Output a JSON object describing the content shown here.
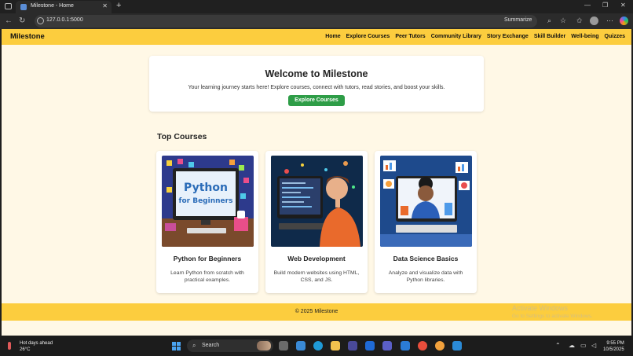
{
  "browser": {
    "tab_title": "Milestone - Home",
    "url": "127.0.0.1:5000",
    "summarize_label": "Summarize"
  },
  "site": {
    "brand": "Milestone",
    "nav": [
      "Home",
      "Explore Courses",
      "Peer Tutors",
      "Community Library",
      "Story Exchange",
      "Skill Builder",
      "Well-being",
      "Quizzes"
    ],
    "accent_color": "#fccd3e",
    "button_color": "#2e9d47"
  },
  "hero": {
    "title": "Welcome to Milestone",
    "subtitle": "Your learning journey starts here! Explore courses, connect with tutors, read stories, and boost your skills.",
    "cta": "Explore Courses"
  },
  "courses": {
    "heading": "Top Courses",
    "items": [
      {
        "title": "Python for Beginners",
        "description": "Learn Python from scratch with practical examples.",
        "image_text": "Python",
        "image_text2": "for Beginners"
      },
      {
        "title": "Web Development",
        "description": "Build modern websites using HTML, CSS, and JS."
      },
      {
        "title": "Data Science Basics",
        "description": "Analyze and visualize data with Python libraries."
      }
    ]
  },
  "footer": {
    "text": "© 2025 Milestone"
  },
  "watermark": {
    "line1": "Activate Windows",
    "line2": "Go to Settings to activate Windows."
  },
  "taskbar": {
    "weather_title": "Hot days ahead",
    "weather_temp": "26°C",
    "search_placeholder": "Search",
    "time": "9:55 PM",
    "date": "10/5/2025"
  }
}
